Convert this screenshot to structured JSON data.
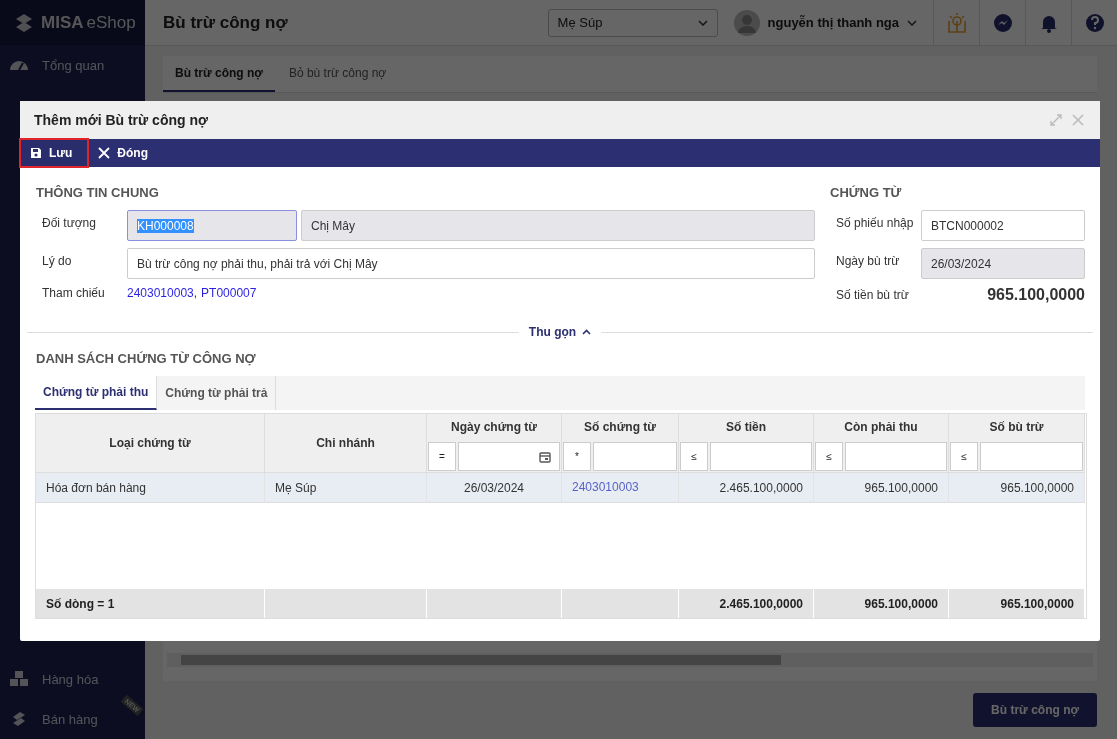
{
  "app": {
    "logo_bold": "MISA",
    "logo_light": "eShop"
  },
  "sidebar": {
    "top_items": [
      {
        "label": "Tổng quan",
        "selected": false
      }
    ],
    "bottom_items": [
      {
        "label": "Hàng hóa",
        "selected": false
      },
      {
        "label": "Bán hàng",
        "selected": false,
        "badge": "NEW"
      }
    ]
  },
  "header": {
    "title": "Bù trừ công nợ",
    "store": "Mẹ Súp",
    "user": "nguyễn thị thanh nga"
  },
  "page_tabs": [
    {
      "label": "Bù trừ công nợ",
      "selected": true
    },
    {
      "label": "Bỏ bù trừ công nợ",
      "selected": false
    }
  ],
  "page_action": "Bù trừ công nợ",
  "dialog": {
    "title": "Thêm mới Bù trừ công nợ",
    "toolbar": [
      {
        "label": "Lưu",
        "kind": "save",
        "highlighted": true
      },
      {
        "label": "Đóng",
        "kind": "close",
        "highlighted": false
      }
    ],
    "general": {
      "heading": "THÔNG TIN CHUNG",
      "object": {
        "label": "Đối tượng",
        "code": "KH000008",
        "code_selected": true,
        "name": "Chị Mây",
        "name_disabled": true
      },
      "reason": {
        "label": "Lý do",
        "value": "Bù trừ công nợ phải thu, phải trả với Chị Mây"
      },
      "reference": {
        "label": "Tham chiếu",
        "links": [
          "2403010003,",
          "PT000007"
        ]
      }
    },
    "voucher": {
      "heading": "CHỨNG TỪ",
      "fields": [
        {
          "label": "Số phiếu nhập",
          "value": "BTCN000002",
          "disabled": false
        },
        {
          "label": "Ngày bù trừ",
          "value": "26/03/2024",
          "disabled": true
        }
      ],
      "amount": {
        "label": "Số tiền bù trừ",
        "value": "965.100,0000"
      }
    },
    "collapse": {
      "label": "Thu gọn",
      "expanded": true
    },
    "list": {
      "heading": "DANH SÁCH CHỨNG TỪ CÔNG NỢ",
      "tabs": [
        {
          "label": "Chứng từ phải thu",
          "selected": true
        },
        {
          "label": "Chứng từ phải trả",
          "selected": false
        }
      ],
      "table": {
        "columns": [
          {
            "label": "Loại chứng từ",
            "kind": "text"
          },
          {
            "label": "Chi nhánh",
            "kind": "text"
          },
          {
            "label": "Ngày chứng từ",
            "kind": "date",
            "filter": {
              "operator": "=",
              "kind": "date"
            }
          },
          {
            "label": "Số chứng từ",
            "kind": "link",
            "filter": {
              "operator": "*",
              "kind": "text"
            }
          },
          {
            "label": "Số tiền",
            "kind": "amount",
            "filter": {
              "operator": "≤",
              "kind": "text"
            }
          },
          {
            "label": "Còn phải thu",
            "kind": "amount",
            "filter": {
              "operator": "≤",
              "kind": "text"
            }
          },
          {
            "label": "Số bù trừ",
            "kind": "amount",
            "filter": {
              "operator": "≤",
              "kind": "text"
            }
          }
        ],
        "rows": [
          {
            "selected": true,
            "cells": [
              "Hóa đơn bán hàng",
              "Mẹ Súp",
              "26/03/2024",
              "2403010003",
              "2.465.100,0000",
              "965.100,0000",
              "965.100,0000"
            ]
          }
        ],
        "footer": {
          "row_count": "Số dòng = 1",
          "totals": [
            "2.465.100,0000",
            "965.100,0000",
            "965.100,0000"
          ]
        }
      }
    }
  }
}
